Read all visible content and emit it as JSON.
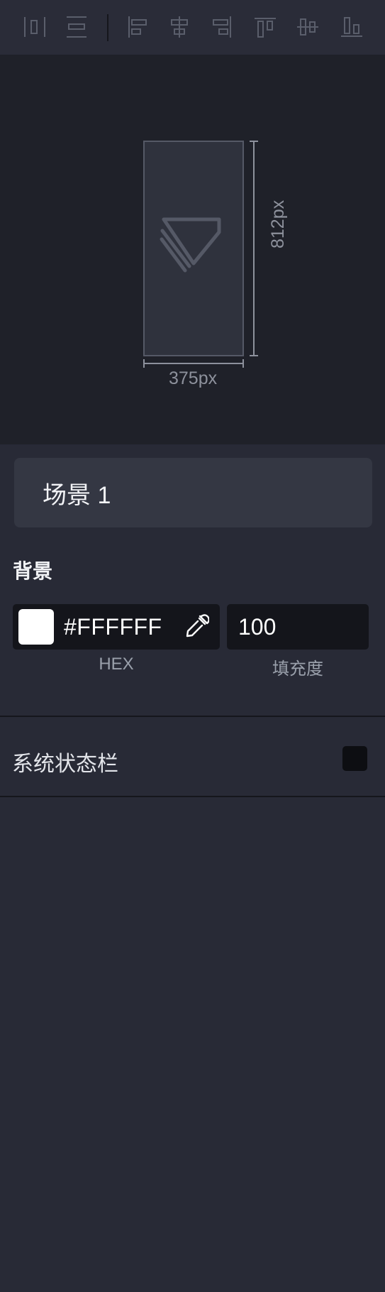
{
  "toolbar": {
    "buttons": [
      {
        "name": "distribute-horizontal-icon"
      },
      {
        "name": "distribute-vertical-icon"
      },
      {
        "name": "align-left-icon"
      },
      {
        "name": "align-center-horizontal-icon"
      },
      {
        "name": "align-right-icon"
      },
      {
        "name": "align-top-icon"
      },
      {
        "name": "align-middle-vertical-icon"
      },
      {
        "name": "align-bottom-icon"
      }
    ]
  },
  "preview": {
    "width_label": "375px",
    "height_label": "812px",
    "icon": "brand-logo-icon"
  },
  "scene": {
    "name": "场景 1"
  },
  "background": {
    "title": "背景",
    "hex_value": "#FFFFFF",
    "swatch_color": "#FFFFFF",
    "hex_caption": "HEX",
    "fill_value": "100",
    "fill_caption": "填充度",
    "eyedropper_icon": "eyedropper-icon"
  },
  "status_bar": {
    "label": "系统状态栏",
    "enabled": false
  },
  "colors": {
    "panel_bg": "#282a36",
    "toolbar_bg": "#2a2c38",
    "preview_bg": "#1f2129",
    "field_bg": "#14151b",
    "accent_stroke": "#555966"
  }
}
